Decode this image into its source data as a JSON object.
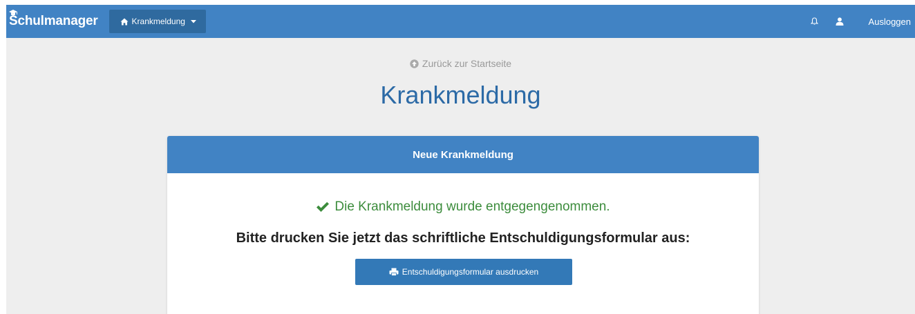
{
  "navbar": {
    "brand": "Schulmanager",
    "dropdown_label": "Krankmeldung",
    "logout_label": "Ausloggen"
  },
  "main": {
    "back_link": "Zurück zur Startseite",
    "title": "Krankmeldung"
  },
  "panel": {
    "heading": "Neue Krankmeldung",
    "success_message": "Die Krankmeldung wurde entgegengenommen.",
    "instruction": "Bitte drucken Sie jetzt das schriftliche Entschuldigungsformular aus:",
    "print_button_label": "Entschuldigungsformular ausdrucken"
  },
  "icons": {
    "brand": "graduation-cap-icon",
    "dropdown": "home-icon",
    "caret": "caret-down-icon",
    "notifications": "bell-icon",
    "profile": "user-icon",
    "back": "circle-arrow-up-icon",
    "success": "checkmark-icon",
    "print": "printer-icon"
  },
  "colors": {
    "primary": "#4183c4",
    "primary_dark": "#2f6a9f",
    "button": "#3379b7",
    "title": "#2c6aa6",
    "success": "#3c8c3c",
    "background": "#eeeeee"
  }
}
